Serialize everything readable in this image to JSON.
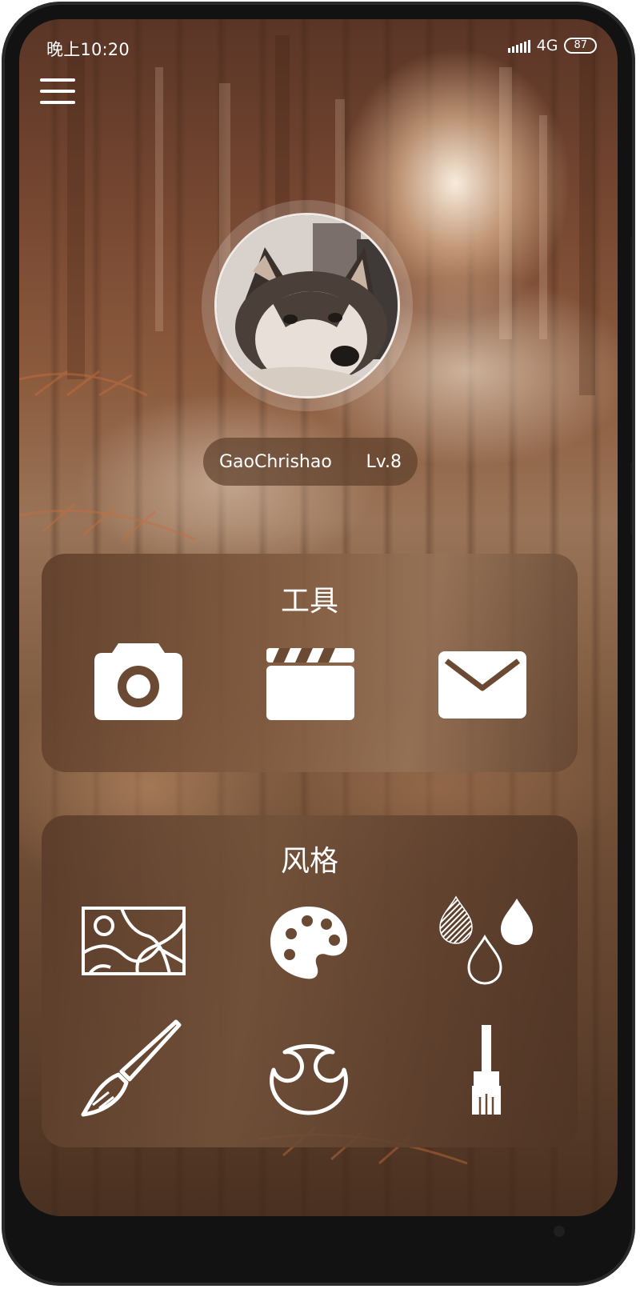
{
  "status_bar": {
    "time": "晚上10:20",
    "network": "4G",
    "battery": "87"
  },
  "profile": {
    "username": "GaoChrishao",
    "level": "Lv.8"
  },
  "tools": {
    "title": "工具",
    "icons": [
      "camera-icon",
      "clapperboard-icon",
      "mail-icon"
    ]
  },
  "style": {
    "title": "风格",
    "icons": [
      "abstract-lines-icon",
      "palette-icon",
      "droplets-icon",
      "paintbrush-icon",
      "bear-icon",
      "flat-brush-icon"
    ]
  },
  "colors": {
    "card_brown": "#6e4a33",
    "icon_white": "#ffffff",
    "icon_cutout": "#6b4a33"
  }
}
